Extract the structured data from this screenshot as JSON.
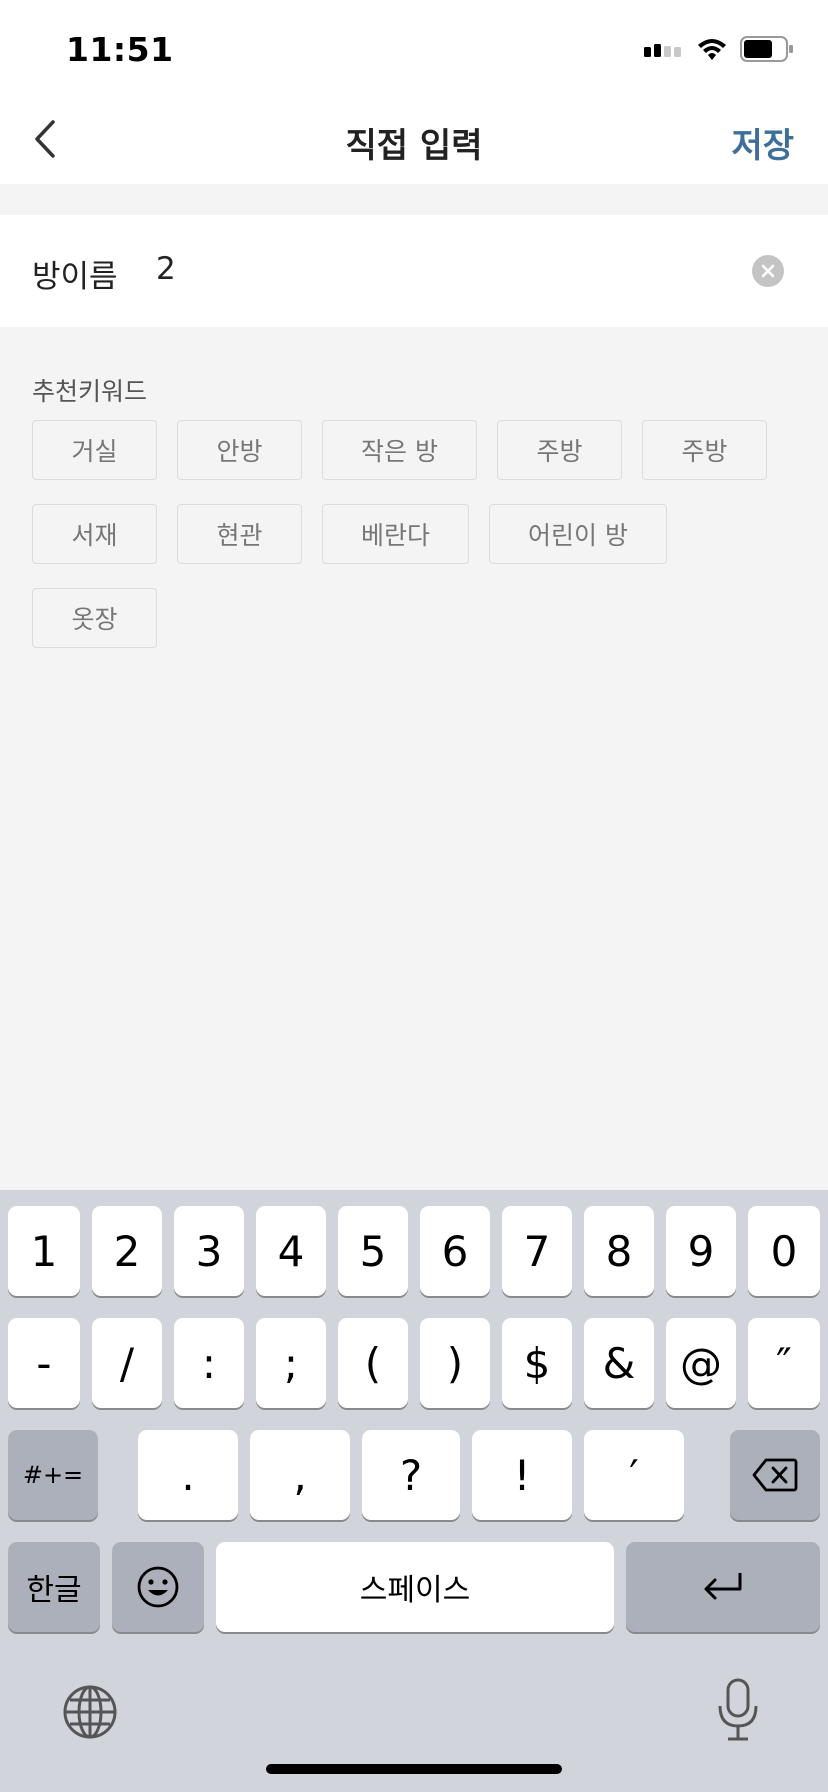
{
  "status": {
    "time": "11:51"
  },
  "nav": {
    "title": "직접 입력",
    "save_label": "저장"
  },
  "input": {
    "label": "방이름",
    "value": "2"
  },
  "keywords": {
    "title": "추천키워드",
    "items": [
      "거실",
      "안방",
      "작은 방",
      "주방",
      "주방",
      "서재",
      "현관",
      "베란다",
      "어린이 방",
      "옷장"
    ]
  },
  "keyboard": {
    "row1": [
      "1",
      "2",
      "3",
      "4",
      "5",
      "6",
      "7",
      "8",
      "9",
      "0"
    ],
    "row2": [
      "-",
      "/",
      ":",
      ";",
      "(",
      ")",
      "$",
      "&",
      "@",
      "″"
    ],
    "row3": {
      "toggle": "#+=",
      "keys": [
        ".",
        ",",
        "?",
        "!",
        "′"
      ]
    },
    "row4": {
      "lang": "한글",
      "space": "스페이스"
    }
  },
  "colors": {
    "accent": "#3f6f98",
    "keyboard_bg": "#d1d4db"
  }
}
